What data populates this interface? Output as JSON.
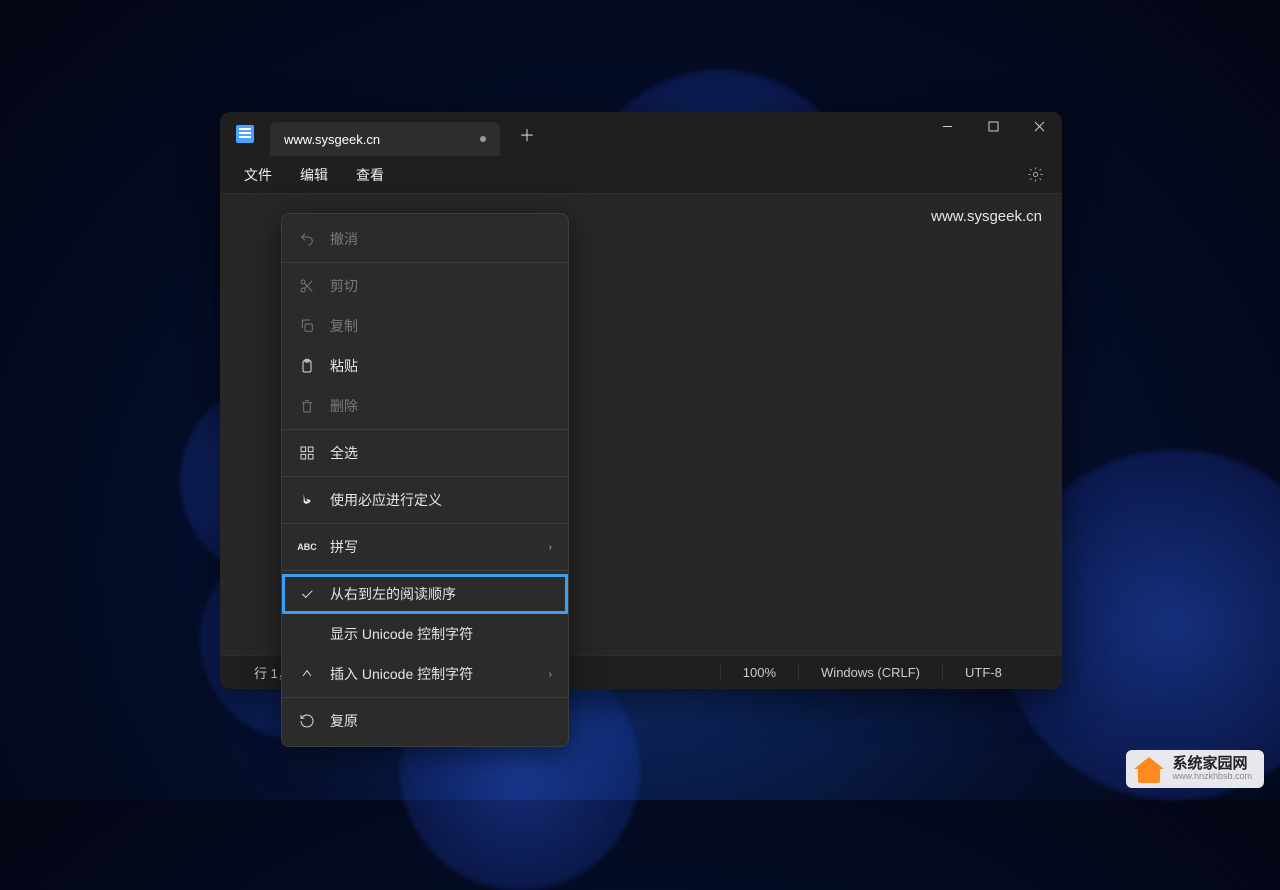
{
  "window": {
    "tab_title": "www.sysgeek.cn"
  },
  "menubar": {
    "file": "文件",
    "edit": "编辑",
    "view": "查看"
  },
  "editor": {
    "content": "www.sysgeek.cn"
  },
  "context_menu": {
    "undo": "撤消",
    "cut": "剪切",
    "copy": "复制",
    "paste": "粘贴",
    "delete": "删除",
    "select_all": "全选",
    "bing_define": "使用必应进行定义",
    "spelling": "拼写",
    "rtl_reading": "从右到左的阅读顺序",
    "show_unicode_ctrl": "显示 Unicode 控制字符",
    "insert_unicode_ctrl": "插入 Unicode 控制字符",
    "restore": "复原"
  },
  "statusbar": {
    "position": "行 1，列",
    "zoom": "100%",
    "line_ending": "Windows (CRLF)",
    "encoding": "UTF-8"
  },
  "watermark": {
    "title": "系统家园网",
    "url": "www.hnzkhbsb.com"
  }
}
